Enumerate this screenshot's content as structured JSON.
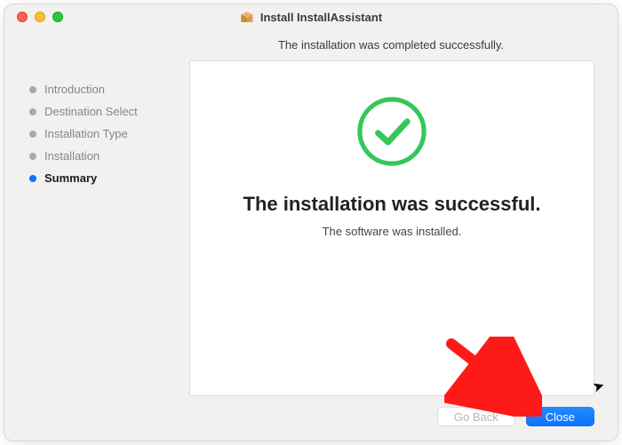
{
  "window": {
    "title": "Install InstallAssistant"
  },
  "heading": "The installation was completed successfully.",
  "sidebar": {
    "steps": [
      {
        "label": "Introduction",
        "current": false
      },
      {
        "label": "Destination Select",
        "current": false
      },
      {
        "label": "Installation Type",
        "current": false
      },
      {
        "label": "Installation",
        "current": false
      },
      {
        "label": "Summary",
        "current": true
      }
    ]
  },
  "panel": {
    "title": "The installation was successful.",
    "subtitle": "The software was installed."
  },
  "buttons": {
    "go_back": "Go Back",
    "close": "Close"
  }
}
